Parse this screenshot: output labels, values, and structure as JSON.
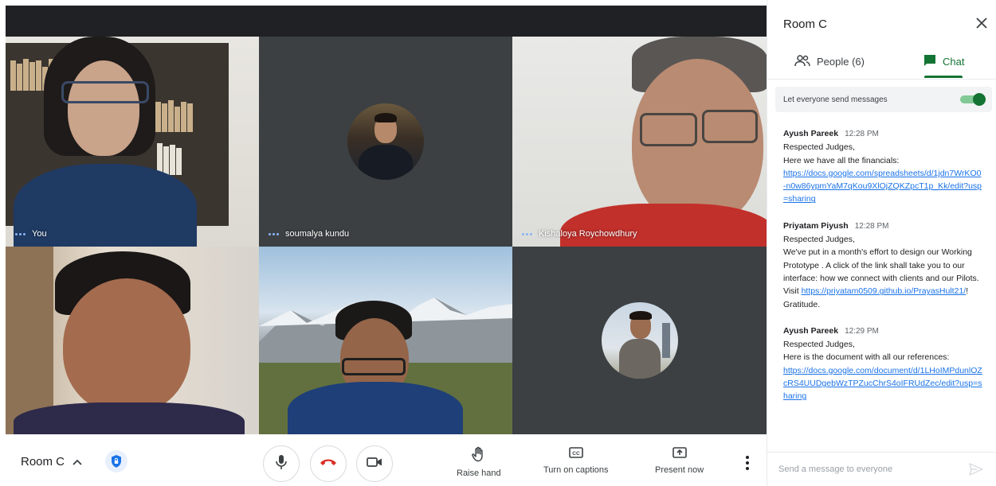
{
  "tiles": [
    {
      "name": "You"
    },
    {
      "name": "soumalya kundu"
    },
    {
      "name": "Kishaloya Roychowdhury"
    }
  ],
  "controls": {
    "room_name": "Room C",
    "raise_hand": "Raise hand",
    "captions": "Turn on captions",
    "present": "Present now"
  },
  "panel": {
    "title": "Room C",
    "people_tab": "People (6)",
    "chat_tab": "Chat",
    "toggle_label": "Let everyone send messages",
    "toggle_on": true,
    "composer_placeholder": "Send a message to everyone"
  },
  "messages": [
    {
      "sender": "Ayush Pareek",
      "time": "12:28 PM",
      "line1": "Respected Judges,",
      "line2": "Here we have all the financials:",
      "link": "https://docs.google.com/spreadsheets/d/1jdn7WrKO0-n0w86ypmYaM7qKou9XlOjZQKZpcT1p_Kk/edit?usp=sharing"
    },
    {
      "sender": "Priyatam Piyush",
      "time": "12:28 PM",
      "line1": "Respected Judges,",
      "line2": "We've put in a month's  effort to design our Working Prototype . A click of the link shall take you to our interface: how we connect with clients and our Pilots.",
      "visit": "Visit ",
      "link": "https://priyatam0509.github.io/PrayasHult21/",
      "after_link": "!",
      "line3": "Gratitude."
    },
    {
      "sender": "Ayush Pareek",
      "time": "12:29 PM",
      "line1": "Respected Judges,",
      "line2": "Here is the document with all our references:",
      "link": "https://docs.google.com/document/d/1LHoIMPdunlOZcRS4UUDgebWzTPZucChrS4oIFRUdZec/edit?usp=sharing"
    }
  ]
}
